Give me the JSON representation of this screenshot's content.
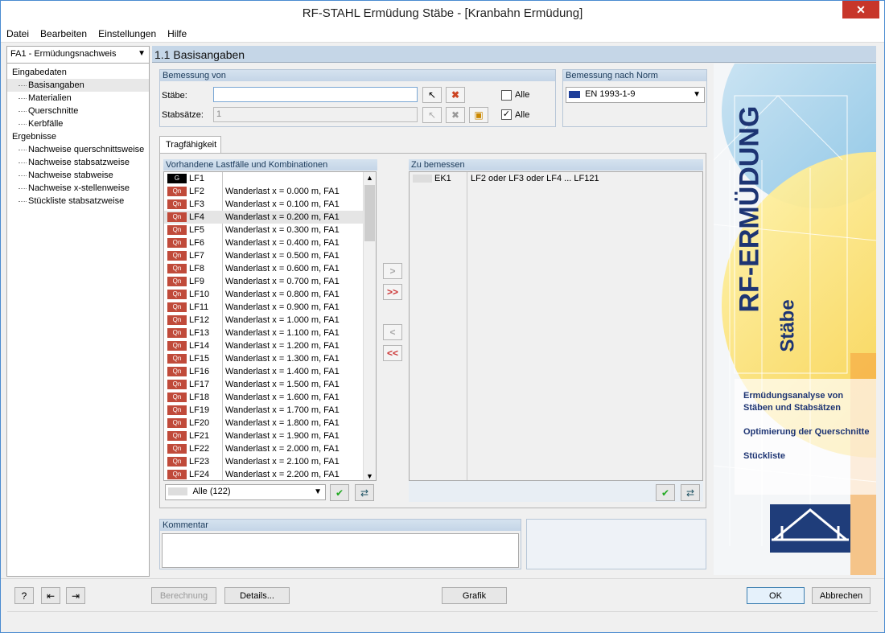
{
  "window": {
    "title": "RF-STAHL Ermüdung Stäbe - [Kranbahn Ermüdung]",
    "close": "✕"
  },
  "menu": [
    "Datei",
    "Bearbeiten",
    "Einstellungen",
    "Hilfe"
  ],
  "nav": {
    "case_select": "FA1 - Ermüdungsnachweis",
    "tree": [
      {
        "label": "Eingabedaten",
        "level": 0
      },
      {
        "label": "Basisangaben",
        "level": 1,
        "selected": true
      },
      {
        "label": "Materialien",
        "level": 1
      },
      {
        "label": "Querschnitte",
        "level": 1
      },
      {
        "label": "Kerbfälle",
        "level": 1
      },
      {
        "label": "Ergebnisse",
        "level": 0
      },
      {
        "label": "Nachweise querschnittsweise",
        "level": 1
      },
      {
        "label": "Nachweise stabsatzweise",
        "level": 1
      },
      {
        "label": "Nachweise stabweise",
        "level": 1
      },
      {
        "label": "Nachweise x-stellenweise",
        "level": 1
      },
      {
        "label": "Stückliste stabsatzweise",
        "level": 1
      }
    ]
  },
  "section_title": "1.1 Basisangaben",
  "design_of": {
    "title": "Bemessung von",
    "members_label": "Stäbe:",
    "members_value": "",
    "sets_label": "Stabsätze:",
    "sets_value": "1",
    "all_label": "Alle",
    "all_members_checked": false,
    "all_sets_checked": true
  },
  "norm": {
    "title": "Bemessung nach Norm",
    "value": "EN 1993-1-9"
  },
  "tab": {
    "label": "Tragfähigkeit"
  },
  "available": {
    "title": "Vorhandene Lastfälle und Kombinationen",
    "filter": "Alle (122)",
    "rows": [
      {
        "badge": "G",
        "name": "LF1",
        "desc": ""
      },
      {
        "badge": "Qn",
        "name": "LF2",
        "desc": "Wanderlast x = 0.000 m, FA1"
      },
      {
        "badge": "Qn",
        "name": "LF3",
        "desc": "Wanderlast x = 0.100 m, FA1"
      },
      {
        "badge": "Qn",
        "name": "LF4",
        "desc": "Wanderlast x = 0.200 m, FA1",
        "selected": true
      },
      {
        "badge": "Qn",
        "name": "LF5",
        "desc": "Wanderlast x = 0.300 m, FA1"
      },
      {
        "badge": "Qn",
        "name": "LF6",
        "desc": "Wanderlast x = 0.400 m, FA1"
      },
      {
        "badge": "Qn",
        "name": "LF7",
        "desc": "Wanderlast x = 0.500 m, FA1"
      },
      {
        "badge": "Qn",
        "name": "LF8",
        "desc": "Wanderlast x = 0.600 m, FA1"
      },
      {
        "badge": "Qn",
        "name": "LF9",
        "desc": "Wanderlast x = 0.700 m, FA1"
      },
      {
        "badge": "Qn",
        "name": "LF10",
        "desc": "Wanderlast x = 0.800 m, FA1"
      },
      {
        "badge": "Qn",
        "name": "LF11",
        "desc": "Wanderlast x = 0.900 m, FA1"
      },
      {
        "badge": "Qn",
        "name": "LF12",
        "desc": "Wanderlast x = 1.000 m, FA1"
      },
      {
        "badge": "Qn",
        "name": "LF13",
        "desc": "Wanderlast x = 1.100 m, FA1"
      },
      {
        "badge": "Qn",
        "name": "LF14",
        "desc": "Wanderlast x = 1.200 m, FA1"
      },
      {
        "badge": "Qn",
        "name": "LF15",
        "desc": "Wanderlast x = 1.300 m, FA1"
      },
      {
        "badge": "Qn",
        "name": "LF16",
        "desc": "Wanderlast x = 1.400 m, FA1"
      },
      {
        "badge": "Qn",
        "name": "LF17",
        "desc": "Wanderlast x = 1.500 m, FA1"
      },
      {
        "badge": "Qn",
        "name": "LF18",
        "desc": "Wanderlast x = 1.600 m, FA1"
      },
      {
        "badge": "Qn",
        "name": "LF19",
        "desc": "Wanderlast x = 1.700 m, FA1"
      },
      {
        "badge": "Qn",
        "name": "LF20",
        "desc": "Wanderlast x = 1.800 m, FA1"
      },
      {
        "badge": "Qn",
        "name": "LF21",
        "desc": "Wanderlast x = 1.900 m, FA1"
      },
      {
        "badge": "Qn",
        "name": "LF22",
        "desc": "Wanderlast x = 2.000 m, FA1"
      },
      {
        "badge": "Qn",
        "name": "LF23",
        "desc": "Wanderlast x = 2.100 m, FA1"
      },
      {
        "badge": "Qn",
        "name": "LF24",
        "desc": "Wanderlast x = 2.200 m, FA1"
      }
    ]
  },
  "to_design": {
    "title": "Zu bemessen",
    "rows": [
      {
        "name": "EK1",
        "desc": "LF2 oder LF3 oder LF4 ... LF121"
      }
    ]
  },
  "transfer": {
    "add": ">",
    "add_all": ">>",
    "remove": "<",
    "remove_all": "<<"
  },
  "comment": {
    "title": "Kommentar",
    "value": ""
  },
  "banner": {
    "title": "RF-ERMÜDUNG",
    "subtitle": "Stäbe",
    "features": [
      "Ermüdungsanalyse von Stäben und Stabsätzen",
      "Optimierung der Querschnitte",
      "Stückliste"
    ]
  },
  "footer": {
    "calc": "Berechnung",
    "details": "Details...",
    "graphics": "Grafik",
    "ok": "OK",
    "cancel": "Abbrechen"
  }
}
